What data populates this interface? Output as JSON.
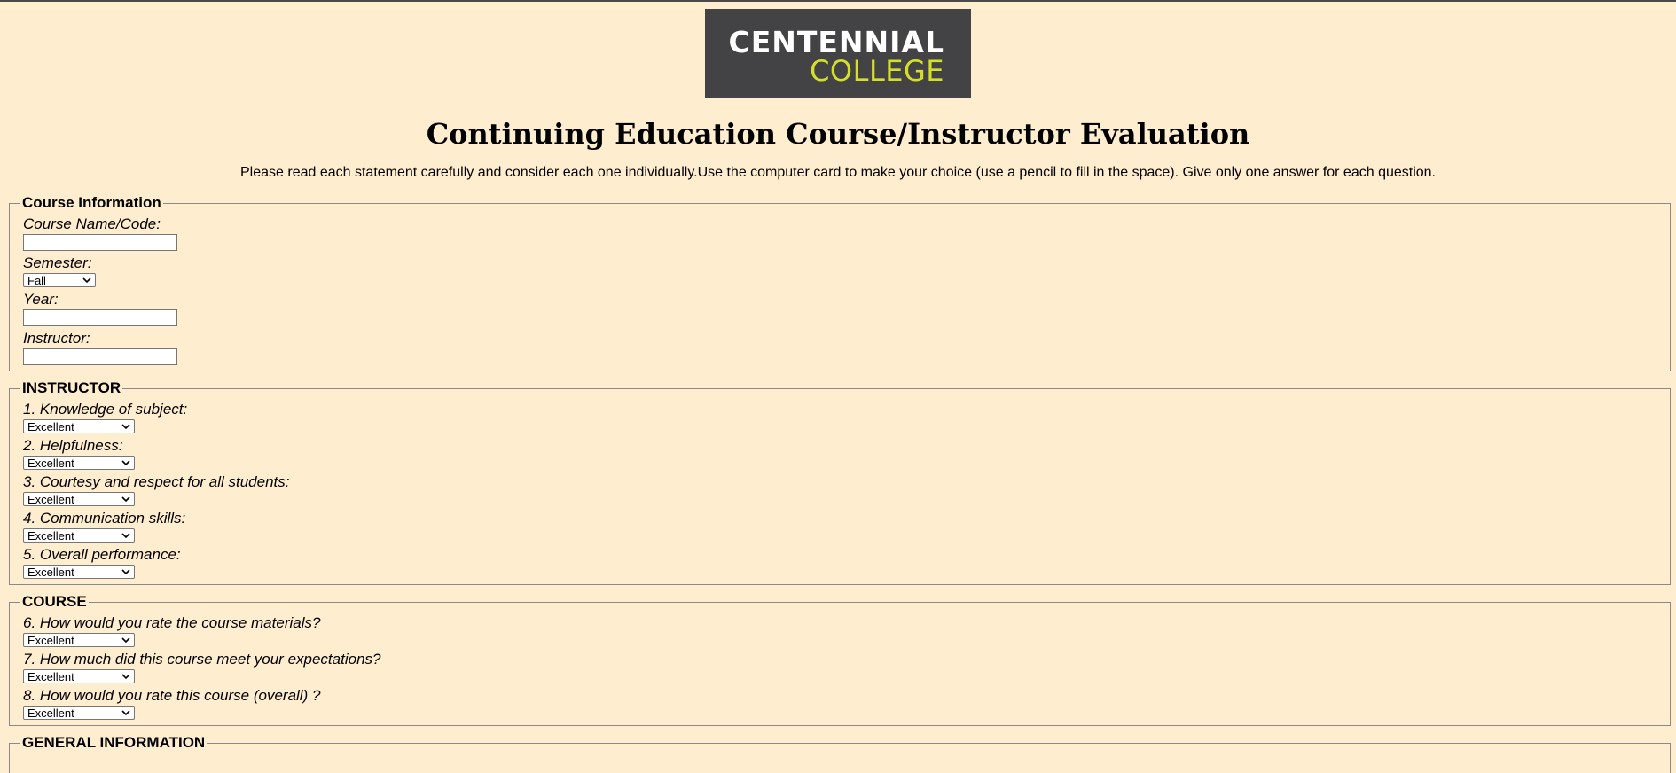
{
  "logo": {
    "line1": "CENTENNIAL",
    "line2": "COLLEGE",
    "bg": "#434345",
    "accent": "#d4df2b"
  },
  "title": "Continuing Education Course/Instructor Evaluation",
  "intro": "Please read each statement carefully and consider each one individually.Use the computer card to make your choice (use a pencil to fill in the space). Give only one answer for each question.",
  "course_info": {
    "legend": "Course Information",
    "course_name_label": "Course Name/Code:",
    "course_name_value": "",
    "semester_label": "Semester:",
    "semester_value": "Fall",
    "year_label": "Year:",
    "year_value": "",
    "instructor_label": "Instructor:",
    "instructor_value": ""
  },
  "instructor": {
    "legend": "INSTRUCTOR",
    "questions": [
      {
        "label": "1. Knowledge of subject:",
        "value": "Excellent"
      },
      {
        "label": "2. Helpfulness:",
        "value": "Excellent"
      },
      {
        "label": "3. Courtesy and respect for all students:",
        "value": "Excellent"
      },
      {
        "label": "4. Communication skills:",
        "value": "Excellent"
      },
      {
        "label": "5. Overall performance:",
        "value": "Excellent"
      }
    ]
  },
  "course": {
    "legend": "COURSE",
    "questions": [
      {
        "label": "6. How would you rate the course materials?",
        "value": "Excellent"
      },
      {
        "label": "7. How much did this course meet your expectations?",
        "value": "Excellent"
      },
      {
        "label": "8. How would you rate this course (overall) ?",
        "value": "Excellent"
      }
    ]
  },
  "general": {
    "legend": "GENERAL INFORMATION"
  },
  "colors": {
    "page_bg": "#ffedcf",
    "border": "#8a8a8a"
  },
  "icons": {
    "dropdown": "chevron-down-icon"
  }
}
